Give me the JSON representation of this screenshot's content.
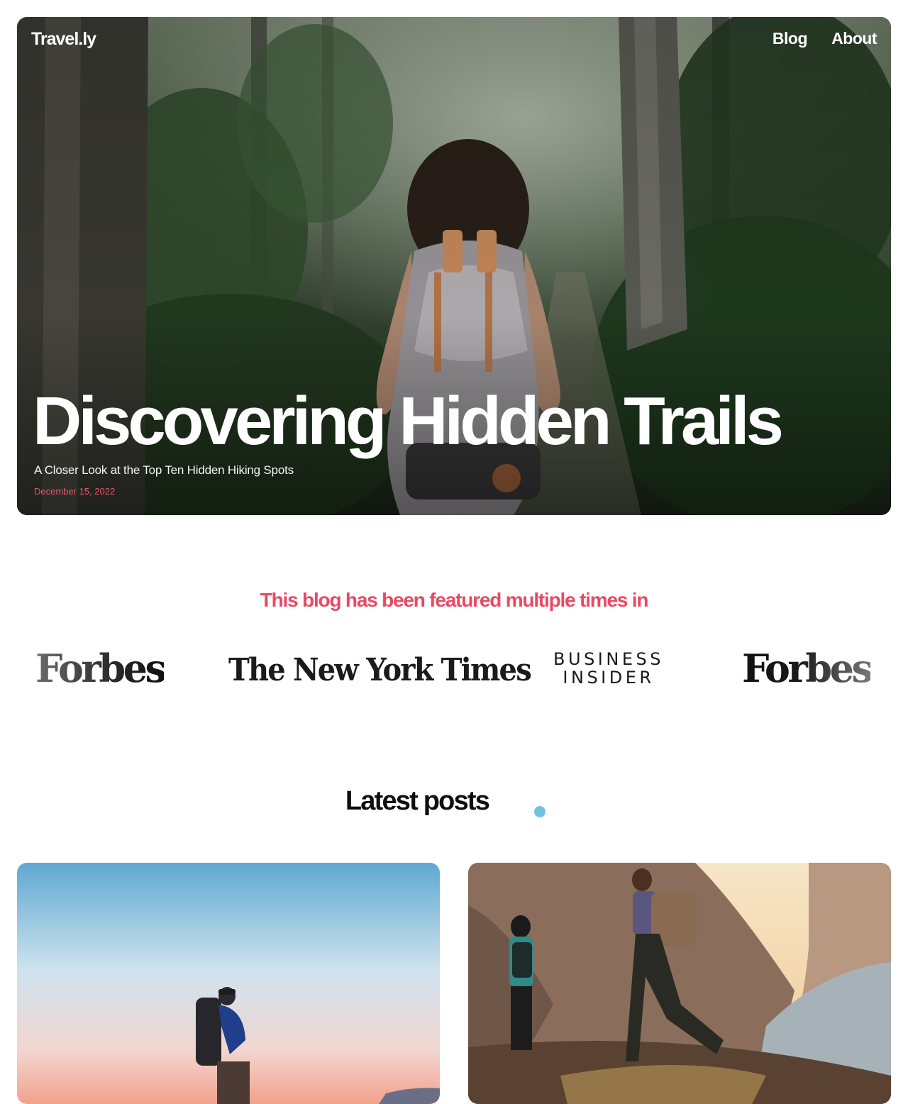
{
  "nav": {
    "logo": "Travel.ly",
    "links": [
      "Blog",
      "About"
    ]
  },
  "hero": {
    "title": "Discovering Hidden Trails",
    "subtitle": "A Closer Look at the Top Ten Hidden Hiking Spots",
    "date": "December 15, 2022",
    "image": "hiker-with-backpack-in-forest"
  },
  "featured": {
    "heading": "This blog has been featured multiple times in",
    "logos": [
      {
        "text": "Forbes"
      },
      {
        "text": "The New York Times"
      },
      {
        "line1": "BUSINESS",
        "line2": "INSIDER"
      },
      {
        "text": "Forbes"
      }
    ]
  },
  "latest": {
    "heading": "Latest posts",
    "posts": [
      {
        "image": "hiker-on-ridge-at-sunset"
      },
      {
        "image": "two-hikers-in-rocky-canyon"
      }
    ]
  },
  "colors": {
    "accent": "#e84a63",
    "dot": "#6fc3e0",
    "text": "#0e0e0e"
  }
}
